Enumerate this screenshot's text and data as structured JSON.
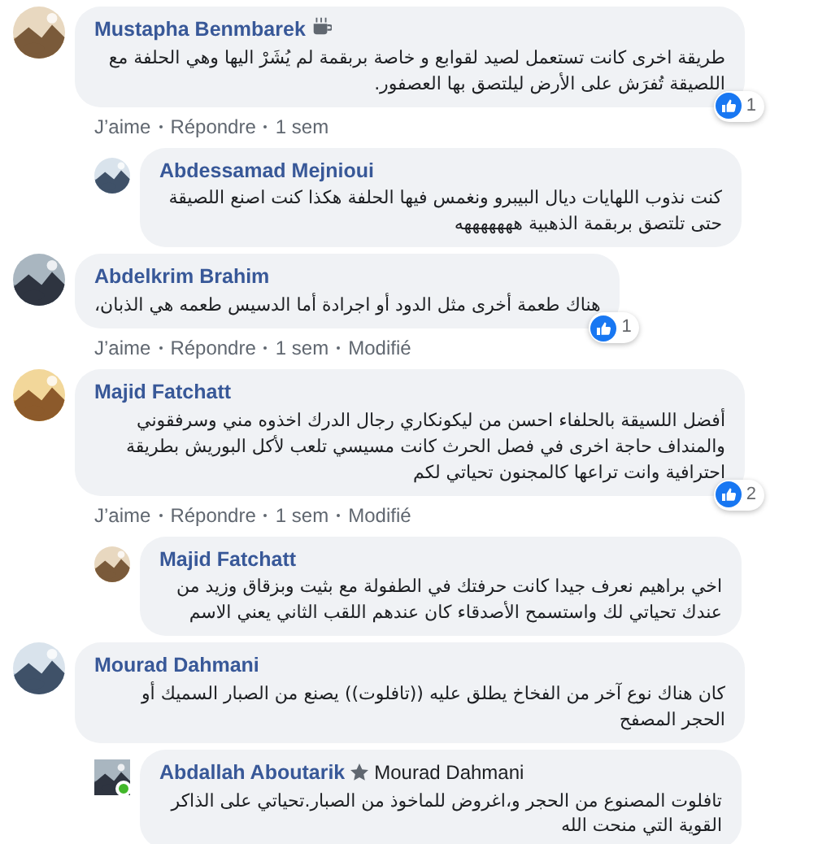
{
  "comments": [
    {
      "author": "Mustapha Benmbarek",
      "badge": {
        "kind": "coffee"
      },
      "text": "طريقة اخرى كانت تستعمل لصيد لقوابع و خاصة بربقمة لم يُشَرْ اليها وهي الحلفة مع اللصيقة تُفرَش على الأرض ليلتصق بها العصفور.",
      "reactions": "1",
      "actions": {
        "like": "J’aime",
        "reply": "Répondre",
        "time": "1 sem"
      },
      "children": [
        {
          "author": "Abdessamad Mejnioui",
          "text": "كنت نذوب اللهايات ديال البيبرو ونغمس فيها الحلفة هكذا كنت اصنع اللصيقة حتى تلتصق بربقمة الذهبية هههههههه"
        }
      ]
    },
    {
      "author": "Abdelkrim Brahim",
      "text": "هناك طعمة أخرى مثل الدود أو اجرادة أما الدسيس طعمه هي الذبان،",
      "reactions": "1",
      "actions": {
        "like": "J’aime",
        "reply": "Répondre",
        "time": "1 sem",
        "edited": "Modifié"
      }
    },
    {
      "author": "Majid Fatchatt",
      "text": "أفضل اللسيقة بالحلفاء احسن من ليكونكاري رجال الدرك اخذوه مني وسرفقوني والمنداف حاجة اخرى في فصل الحرث كانت مسيسي تلعب لأكل البوريش بطريقة احترافية وانت تراعها كالمجنون تحياتي لكم",
      "reactions": "2",
      "actions": {
        "like": "J’aime",
        "reply": "Répondre",
        "time": "1 sem",
        "edited": "Modifié"
      },
      "children": [
        {
          "author": "Majid Fatchatt",
          "text": "اخي براهيم نعرف جيدا كانت حرفتك في الطفولة مع بثيت وبزقاق وزيد من عندك تحياتي لك واستسمح الأصدقاء كان عندهم اللقب الثاني يعني الاسم"
        }
      ]
    },
    {
      "author": "Mourad Dahmani",
      "text": "كان هناك نوع آخر من الفخاخ يطلق عليه ((تافلوت)) يصنع من الصبار السميك أو الحجر المصفح",
      "children": [
        {
          "author": "Abdallah Aboutarik",
          "badge": {
            "kind": "star"
          },
          "online": true,
          "mention": "Mourad Dahmani",
          "text": "تافلوت المصنوع من الحجر و،اغروض للماخوذ من الصبار.تحياتي على الذاكر القوية التي منحت الله"
        }
      ]
    }
  ]
}
